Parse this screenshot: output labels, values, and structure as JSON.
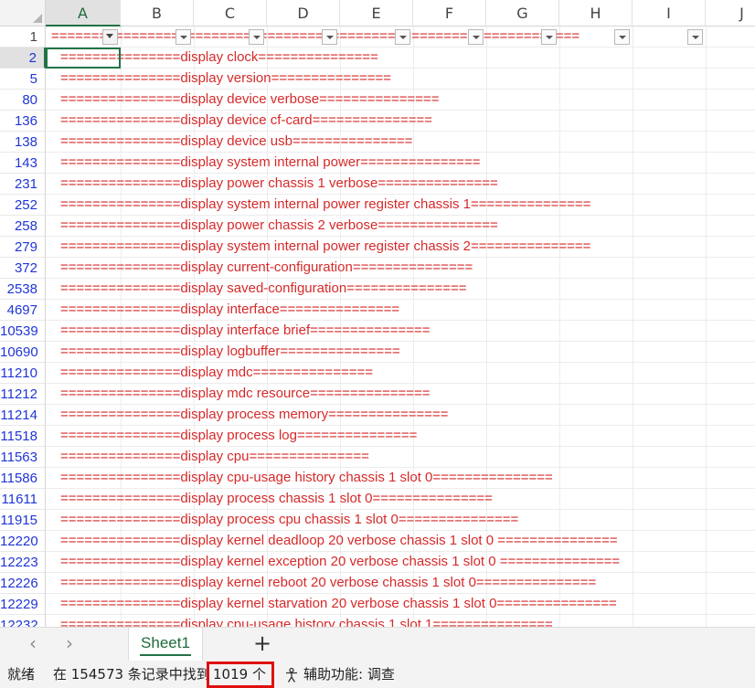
{
  "columns": [
    "A",
    "B",
    "C",
    "D",
    "E",
    "F",
    "G",
    "H",
    "I",
    "J"
  ],
  "rows": [
    {
      "num": "1",
      "text": "=================================================================="
    },
    {
      "num": "2",
      "text": "===============display clock==============="
    },
    {
      "num": "5",
      "text": "===============display version==============="
    },
    {
      "num": "80",
      "text": "===============display device verbose==============="
    },
    {
      "num": "136",
      "text": "===============display device cf-card==============="
    },
    {
      "num": "138",
      "text": "===============display device usb==============="
    },
    {
      "num": "143",
      "text": "===============display system internal power==============="
    },
    {
      "num": "231",
      "text": "===============display power chassis 1 verbose==============="
    },
    {
      "num": "252",
      "text": "===============display system internal power register chassis 1==============="
    },
    {
      "num": "258",
      "text": "===============display power chassis 2 verbose==============="
    },
    {
      "num": "279",
      "text": "===============display system internal power register chassis 2==============="
    },
    {
      "num": "372",
      "text": "===============display current-configuration==============="
    },
    {
      "num": "2538",
      "text": "===============display saved-configuration==============="
    },
    {
      "num": "4697",
      "text": "===============display interface==============="
    },
    {
      "num": "10539",
      "text": "===============display interface brief==============="
    },
    {
      "num": "10690",
      "text": "===============display logbuffer==============="
    },
    {
      "num": "11210",
      "text": "===============display mdc==============="
    },
    {
      "num": "11212",
      "text": "===============display mdc resource==============="
    },
    {
      "num": "11214",
      "text": "===============display process memory==============="
    },
    {
      "num": "11518",
      "text": "===============display process log==============="
    },
    {
      "num": "11563",
      "text": "===============display cpu==============="
    },
    {
      "num": "11586",
      "text": "===============display cpu-usage history chassis 1 slot 0==============="
    },
    {
      "num": "11611",
      "text": "===============display process chassis 1 slot 0==============="
    },
    {
      "num": "11915",
      "text": "===============display process cpu chassis 1 slot 0==============="
    },
    {
      "num": "12220",
      "text": "===============display kernel deadloop 20 verbose chassis 1 slot 0 ==============="
    },
    {
      "num": "12223",
      "text": "===============display kernel exception 20 verbose chassis 1 slot 0 ==============="
    },
    {
      "num": "12226",
      "text": "===============display kernel reboot 20 verbose chassis 1 slot 0==============="
    },
    {
      "num": "12229",
      "text": "===============display kernel starvation 20 verbose chassis 1 slot 0==============="
    },
    {
      "num": "12232",
      "text": "===============display cpu-usage history chassis 1 slot 1==============="
    }
  ],
  "sheet_tab": "Sheet1",
  "nav": {
    "prev": "‹",
    "next": "›",
    "add": "+"
  },
  "status": {
    "ready": "就绪",
    "found": "在 154573 条记录中找到",
    "count": "1019 个",
    "accessibility": "辅助功能: 调查"
  },
  "colors": {
    "accent": "#217346",
    "row_number": "#1f35d6",
    "cell_text": "#d62a2a",
    "highlight_box": "#e01010"
  }
}
